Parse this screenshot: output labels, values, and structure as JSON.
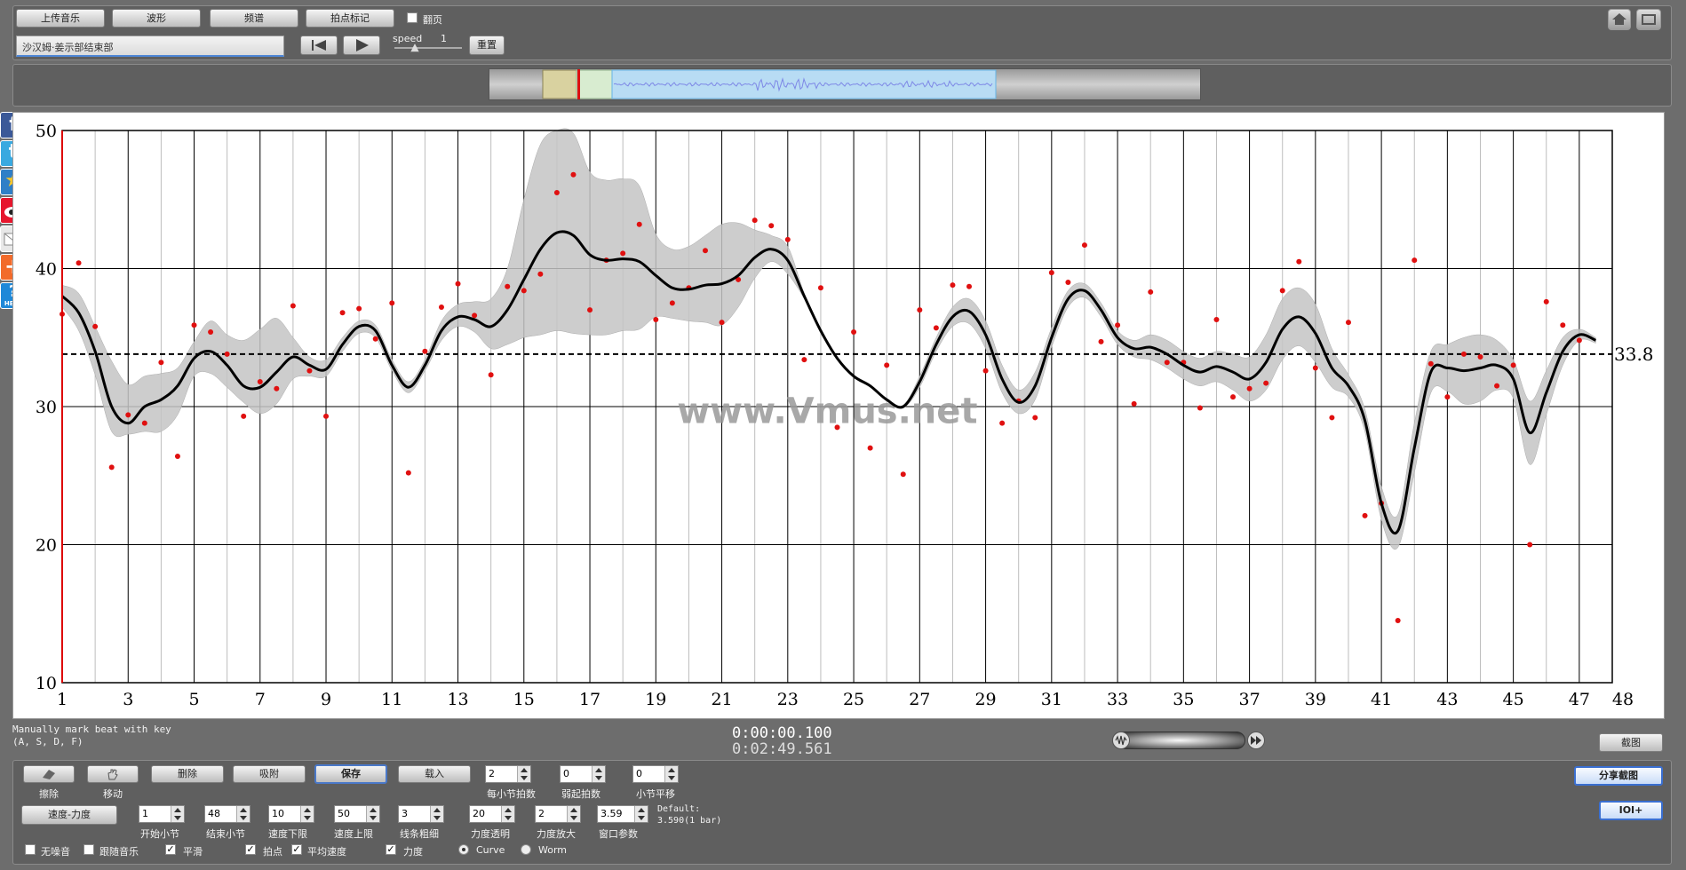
{
  "toolbar": {
    "upload_music": "上传音乐",
    "waveform": "波形",
    "spectrum": "频谱",
    "beat_mark": "拍点标记",
    "flip_page": "翻页",
    "track_title": "沙汉姆·姜示部结束部",
    "speed_label": "speed",
    "speed_value": "1",
    "reset": "重置"
  },
  "social": {
    "facebook": "f",
    "twitter": "t",
    "add": "+",
    "help": "?",
    "help_text": "HELP"
  },
  "chart_data": {
    "type": "line",
    "title": "",
    "xlabel": "",
    "ylabel": "",
    "x_ticks": [
      1,
      3,
      5,
      7,
      9,
      11,
      13,
      15,
      17,
      19,
      21,
      23,
      25,
      27,
      29,
      31,
      33,
      35,
      37,
      39,
      41,
      43,
      45,
      47,
      48
    ],
    "y_ticks": [
      10,
      20,
      30,
      40,
      50
    ],
    "xlim": [
      1,
      48
    ],
    "ylim": [
      10,
      50
    ],
    "grid": true,
    "average": 33.8,
    "average_label": "33.8",
    "watermark": "www.Vmus.net",
    "curve": [
      [
        1.0,
        38
      ],
      [
        1.5,
        36.8
      ],
      [
        2.0,
        34
      ],
      [
        2.5,
        30
      ],
      [
        3.0,
        28.8
      ],
      [
        3.5,
        30
      ],
      [
        4.0,
        30.5
      ],
      [
        4.5,
        31.5
      ],
      [
        5.0,
        33.5
      ],
      [
        5.5,
        34
      ],
      [
        6.0,
        33
      ],
      [
        6.5,
        31.5
      ],
      [
        7.0,
        31.4
      ],
      [
        7.5,
        32.5
      ],
      [
        8.0,
        33.6
      ],
      [
        8.5,
        33
      ],
      [
        9.0,
        32.7
      ],
      [
        9.5,
        34.5
      ],
      [
        10.0,
        35.8
      ],
      [
        10.5,
        35.5
      ],
      [
        11.0,
        33
      ],
      [
        11.5,
        31.4
      ],
      [
        12.0,
        33
      ],
      [
        12.5,
        35.5
      ],
      [
        13.0,
        36.5
      ],
      [
        13.5,
        36.3
      ],
      [
        14.0,
        35.8
      ],
      [
        14.5,
        37
      ],
      [
        15.0,
        39.2
      ],
      [
        15.5,
        41.4
      ],
      [
        16.0,
        42.6
      ],
      [
        16.5,
        42.4
      ],
      [
        17.0,
        41
      ],
      [
        17.5,
        40.6
      ],
      [
        18.0,
        40.7
      ],
      [
        18.5,
        40.5
      ],
      [
        19.0,
        39.5
      ],
      [
        19.5,
        38.6
      ],
      [
        20.0,
        38.5
      ],
      [
        20.5,
        38.8
      ],
      [
        21.0,
        38.9
      ],
      [
        21.5,
        39.5
      ],
      [
        22.0,
        40.8
      ],
      [
        22.5,
        41.4
      ],
      [
        23.0,
        40.6
      ],
      [
        23.5,
        38
      ],
      [
        24.0,
        35.5
      ],
      [
        24.5,
        33.5
      ],
      [
        25.0,
        32.2
      ],
      [
        25.5,
        31.5
      ],
      [
        26.0,
        30.5
      ],
      [
        26.5,
        30
      ],
      [
        27.0,
        31.8
      ],
      [
        27.5,
        34.5
      ],
      [
        28.0,
        36.5
      ],
      [
        28.5,
        36.9
      ],
      [
        29.0,
        35.2
      ],
      [
        29.5,
        32
      ],
      [
        30.0,
        30.3
      ],
      [
        30.5,
        31.5
      ],
      [
        31.0,
        35
      ],
      [
        31.5,
        37.8
      ],
      [
        32.0,
        38.4
      ],
      [
        32.5,
        37
      ],
      [
        33.0,
        35
      ],
      [
        33.5,
        34.2
      ],
      [
        34.0,
        34.3
      ],
      [
        34.5,
        33.8
      ],
      [
        35.0,
        33
      ],
      [
        35.5,
        32.5
      ],
      [
        36.0,
        32.9
      ],
      [
        36.5,
        32.5
      ],
      [
        37.0,
        32
      ],
      [
        37.5,
        33.2
      ],
      [
        38.0,
        35.6
      ],
      [
        38.5,
        36.5
      ],
      [
        39.0,
        35.3
      ],
      [
        39.5,
        32.8
      ],
      [
        40.0,
        31.5
      ],
      [
        40.5,
        29
      ],
      [
        41.0,
        23
      ],
      [
        41.5,
        21
      ],
      [
        42.0,
        27
      ],
      [
        42.5,
        32.5
      ],
      [
        43.0,
        32.8
      ],
      [
        43.5,
        32.6
      ],
      [
        44.0,
        32.8
      ],
      [
        44.5,
        33
      ],
      [
        45.0,
        32
      ],
      [
        45.5,
        28.1
      ],
      [
        46.0,
        31
      ],
      [
        46.5,
        34
      ],
      [
        47.0,
        35.2
      ],
      [
        47.5,
        34.8
      ]
    ],
    "band_upper": [
      [
        1.0,
        38.8
      ],
      [
        1.5,
        38.2
      ],
      [
        2.0,
        35.8
      ],
      [
        2.5,
        33.3
      ],
      [
        3.0,
        31.6
      ],
      [
        3.5,
        32.2
      ],
      [
        4.0,
        32.4
      ],
      [
        4.5,
        32.8
      ],
      [
        5.0,
        34.7
      ],
      [
        5.5,
        36.2
      ],
      [
        6.0,
        35.2
      ],
      [
        6.5,
        34.8
      ],
      [
        7.0,
        35.6
      ],
      [
        7.5,
        36.4
      ],
      [
        8.0,
        35
      ],
      [
        8.5,
        33.6
      ],
      [
        9.0,
        33.4
      ],
      [
        9.5,
        35
      ],
      [
        10.0,
        36.2
      ],
      [
        10.5,
        35.9
      ],
      [
        11.0,
        33.4
      ],
      [
        11.5,
        31.8
      ],
      [
        12.0,
        33.4
      ],
      [
        12.5,
        36.2
      ],
      [
        13.0,
        37.4
      ],
      [
        13.5,
        37.6
      ],
      [
        14.0,
        37.8
      ],
      [
        14.5,
        40
      ],
      [
        15.0,
        45
      ],
      [
        15.5,
        49
      ],
      [
        16.0,
        50
      ],
      [
        16.5,
        49.8
      ],
      [
        17.0,
        47
      ],
      [
        17.5,
        46.4
      ],
      [
        18.0,
        46.5
      ],
      [
        18.5,
        46
      ],
      [
        19.0,
        42.5
      ],
      [
        19.5,
        41.4
      ],
      [
        20.0,
        41.6
      ],
      [
        20.5,
        42.4
      ],
      [
        21.0,
        43.2
      ],
      [
        21.5,
        43.3
      ],
      [
        22.0,
        42.8
      ],
      [
        22.5,
        42.4
      ],
      [
        23.0,
        41.6
      ],
      [
        23.5,
        38.2
      ],
      [
        24.0,
        35.6
      ],
      [
        24.5,
        33.6
      ],
      [
        25.0,
        32.3
      ],
      [
        25.5,
        31.6
      ],
      [
        26.0,
        30.6
      ],
      [
        26.5,
        30.1
      ],
      [
        27.0,
        32.2
      ],
      [
        27.5,
        35
      ],
      [
        28.0,
        37.2
      ],
      [
        28.5,
        37.8
      ],
      [
        29.0,
        36.2
      ],
      [
        29.5,
        33
      ],
      [
        30.0,
        31.2
      ],
      [
        30.5,
        32.5
      ],
      [
        31.0,
        35.7
      ],
      [
        31.5,
        38.4
      ],
      [
        32.0,
        38.9
      ],
      [
        32.5,
        37.5
      ],
      [
        33.0,
        35.5
      ],
      [
        33.5,
        34.8
      ],
      [
        34.0,
        35.2
      ],
      [
        34.5,
        34.8
      ],
      [
        35.0,
        34
      ],
      [
        35.5,
        33.5
      ],
      [
        36.0,
        34
      ],
      [
        36.5,
        33.8
      ],
      [
        37.0,
        33.6
      ],
      [
        37.5,
        35.2
      ],
      [
        38.0,
        37.8
      ],
      [
        38.5,
        38.6
      ],
      [
        39.0,
        37.4
      ],
      [
        39.5,
        34.2
      ],
      [
        40.0,
        32.3
      ],
      [
        40.5,
        29.8
      ],
      [
        41.0,
        24.2
      ],
      [
        41.5,
        22.2
      ],
      [
        42.0,
        28.8
      ],
      [
        42.5,
        34
      ],
      [
        43.0,
        34.5
      ],
      [
        43.5,
        35
      ],
      [
        44.0,
        35.2
      ],
      [
        44.5,
        34.8
      ],
      [
        45.0,
        33.4
      ],
      [
        45.5,
        30.4
      ],
      [
        46.0,
        32.6
      ],
      [
        46.5,
        35
      ],
      [
        47.0,
        35.6
      ],
      [
        47.5,
        35
      ]
    ],
    "band_lower": [
      [
        1.0,
        37.2
      ],
      [
        1.5,
        35.5
      ],
      [
        2.0,
        32.3
      ],
      [
        2.5,
        28.2
      ],
      [
        3.0,
        28
      ],
      [
        3.5,
        28.2
      ],
      [
        4.0,
        28.2
      ],
      [
        4.5,
        29.4
      ],
      [
        5.0,
        32.2
      ],
      [
        5.5,
        32.4
      ],
      [
        6.0,
        31.4
      ],
      [
        6.5,
        30.3
      ],
      [
        7.0,
        29.5
      ],
      [
        7.5,
        30.2
      ],
      [
        8.0,
        32
      ],
      [
        8.5,
        32.2
      ],
      [
        9.0,
        32.2
      ],
      [
        9.5,
        34
      ],
      [
        10.0,
        35.3
      ],
      [
        10.5,
        35
      ],
      [
        11.0,
        32.6
      ],
      [
        11.5,
        31
      ],
      [
        12.0,
        32.6
      ],
      [
        12.5,
        34.8
      ],
      [
        13.0,
        35.8
      ],
      [
        13.5,
        35.4
      ],
      [
        14.0,
        34.2
      ],
      [
        14.5,
        34.5
      ],
      [
        15.0,
        35
      ],
      [
        15.5,
        35.2
      ],
      [
        16.0,
        35.5
      ],
      [
        16.5,
        35.3
      ],
      [
        17.0,
        35.2
      ],
      [
        17.5,
        35.2
      ],
      [
        18.0,
        35.5
      ],
      [
        18.5,
        35.6
      ],
      [
        19.0,
        36.5
      ],
      [
        19.5,
        36.4
      ],
      [
        20.0,
        36.2
      ],
      [
        20.5,
        36.1
      ],
      [
        21.0,
        35.9
      ],
      [
        21.5,
        37.2
      ],
      [
        22.0,
        39.3
      ],
      [
        22.5,
        40.5
      ],
      [
        23.0,
        39.6
      ],
      [
        23.5,
        37.8
      ],
      [
        24.0,
        35.4
      ],
      [
        24.5,
        33.4
      ],
      [
        25.0,
        32.1
      ],
      [
        25.5,
        31.4
      ],
      [
        26.0,
        30.4
      ],
      [
        26.5,
        29.9
      ],
      [
        27.0,
        31.4
      ],
      [
        27.5,
        34
      ],
      [
        28.0,
        35.8
      ],
      [
        28.5,
        36
      ],
      [
        29.0,
        34.2
      ],
      [
        29.5,
        31
      ],
      [
        30.0,
        29.5
      ],
      [
        30.5,
        30.5
      ],
      [
        31.0,
        34.3
      ],
      [
        31.5,
        37.2
      ],
      [
        32.0,
        37.9
      ],
      [
        32.5,
        36.5
      ],
      [
        33.0,
        34.5
      ],
      [
        33.5,
        33.6
      ],
      [
        34.0,
        33.4
      ],
      [
        34.5,
        32.8
      ],
      [
        35.0,
        32
      ],
      [
        35.5,
        31.5
      ],
      [
        36.0,
        31.8
      ],
      [
        36.5,
        31.2
      ],
      [
        37.0,
        30.4
      ],
      [
        37.5,
        31.2
      ],
      [
        38.0,
        33.4
      ],
      [
        38.5,
        34.4
      ],
      [
        39.0,
        33.2
      ],
      [
        39.5,
        31.4
      ],
      [
        40.0,
        30.7
      ],
      [
        40.5,
        28.2
      ],
      [
        41.0,
        21.8
      ],
      [
        41.5,
        19.8
      ],
      [
        42.0,
        25.2
      ],
      [
        42.5,
        31
      ],
      [
        43.0,
        31.1
      ],
      [
        43.5,
        30.2
      ],
      [
        44.0,
        30.4
      ],
      [
        44.5,
        31.2
      ],
      [
        45.0,
        30.6
      ],
      [
        45.5,
        25.8
      ],
      [
        46.0,
        29.4
      ],
      [
        46.5,
        33
      ],
      [
        47.0,
        34.8
      ],
      [
        47.5,
        34.6
      ]
    ],
    "points": [
      [
        1.0,
        36.7
      ],
      [
        1.5,
        40.4
      ],
      [
        2.0,
        35.8
      ],
      [
        2.5,
        25.6
      ],
      [
        3.0,
        29.4
      ],
      [
        3.5,
        28.8
      ],
      [
        4.0,
        33.2
      ],
      [
        4.5,
        26.4
      ],
      [
        5.0,
        35.9
      ],
      [
        5.5,
        35.4
      ],
      [
        6.0,
        33.8
      ],
      [
        6.5,
        29.3
      ],
      [
        7.0,
        31.8
      ],
      [
        7.5,
        31.3
      ],
      [
        8.0,
        37.3
      ],
      [
        8.5,
        32.6
      ],
      [
        9.0,
        29.3
      ],
      [
        9.5,
        36.8
      ],
      [
        10.0,
        37.1
      ],
      [
        10.5,
        34.9
      ],
      [
        11.0,
        37.5
      ],
      [
        11.5,
        25.2
      ],
      [
        12.0,
        34
      ],
      [
        12.5,
        37.2
      ],
      [
        13.0,
        38.9
      ],
      [
        13.5,
        36.6
      ],
      [
        14.0,
        32.3
      ],
      [
        14.5,
        38.7
      ],
      [
        15.0,
        38.4
      ],
      [
        15.5,
        39.6
      ],
      [
        16.0,
        45.5
      ],
      [
        16.5,
        46.8
      ],
      [
        17.0,
        37
      ],
      [
        17.5,
        40.6
      ],
      [
        18.0,
        41.1
      ],
      [
        18.5,
        43.2
      ],
      [
        19.0,
        36.3
      ],
      [
        19.5,
        37.5
      ],
      [
        20.0,
        38.6
      ],
      [
        20.5,
        41.3
      ],
      [
        21.0,
        36.1
      ],
      [
        21.5,
        39.2
      ],
      [
        22.0,
        43.5
      ],
      [
        22.5,
        43.1
      ],
      [
        23.0,
        42.1
      ],
      [
        23.5,
        33.4
      ],
      [
        24.0,
        38.6
      ],
      [
        24.5,
        28.5
      ],
      [
        25.0,
        35.4
      ],
      [
        25.5,
        27
      ],
      [
        26.0,
        33
      ],
      [
        26.5,
        25.1
      ],
      [
        27.0,
        37
      ],
      [
        27.5,
        35.7
      ],
      [
        28.0,
        38.8
      ],
      [
        28.5,
        38.7
      ],
      [
        29.0,
        32.6
      ],
      [
        29.5,
        28.8
      ],
      [
        30.0,
        30.4
      ],
      [
        30.5,
        29.2
      ],
      [
        31.0,
        39.7
      ],
      [
        31.5,
        39
      ],
      [
        32.0,
        41.7
      ],
      [
        32.5,
        34.7
      ],
      [
        33.0,
        35.9
      ],
      [
        33.5,
        30.2
      ],
      [
        34.0,
        38.3
      ],
      [
        34.5,
        33.2
      ],
      [
        35.0,
        33.2
      ],
      [
        35.5,
        29.9
      ],
      [
        36.0,
        36.3
      ],
      [
        36.5,
        30.7
      ],
      [
        37.0,
        31.3
      ],
      [
        37.5,
        31.7
      ],
      [
        38.0,
        38.4
      ],
      [
        38.5,
        40.5
      ],
      [
        39.0,
        32.8
      ],
      [
        39.5,
        29.2
      ],
      [
        40.0,
        36.1
      ],
      [
        40.5,
        22.1
      ],
      [
        41.0,
        23
      ],
      [
        41.5,
        14.5
      ],
      [
        42.0,
        40.6
      ],
      [
        42.5,
        33.1
      ],
      [
        43.0,
        30.7
      ],
      [
        43.5,
        33.8
      ],
      [
        44.0,
        33.6
      ],
      [
        44.5,
        31.5
      ],
      [
        45.0,
        33
      ],
      [
        45.5,
        20
      ],
      [
        46.0,
        37.6
      ],
      [
        46.5,
        35.9
      ],
      [
        47.0,
        34.8
      ]
    ]
  },
  "status": {
    "hint_line1": "Manually mark beat with key",
    "hint_line2": "(A, S, D, F)",
    "current_time": "0:00:00.100",
    "total_time": "0:02:49.561",
    "screenshot": "截图"
  },
  "bottom": {
    "erase": "擦除",
    "move": "移动",
    "delete": "删除",
    "snap": "吸附",
    "save": "保存",
    "load": "载入",
    "beats_per_bar_val": "2",
    "beats_per_bar": "每小节拍数",
    "pickup_beats_val": "0",
    "pickup_beats": "弱起拍数",
    "bar_offset_val": "0",
    "bar_offset": "小节平移",
    "tempo_dynamics": "速度-力度",
    "start_bar_val": "1",
    "start_bar": "开始小节",
    "end_bar_val": "48",
    "end_bar": "结束小节",
    "tempo_min_val": "10",
    "tempo_min": "速度下限",
    "tempo_max_val": "50",
    "tempo_max": "速度上限",
    "curve_width_val": "3",
    "curve_width": "线条粗细",
    "dyn_transparency_val": "20",
    "dyn_transparency": "力度透明",
    "dyn_zoom_val": "2",
    "dyn_zoom": "力度放大",
    "window_param_val": "3.59",
    "window_param": "窗口参数",
    "default_line1": "Default:",
    "default_line2": "3.590(1 bar)",
    "no_noise": "无噪音",
    "follow_music": "跟随音乐",
    "smooth": "平滑",
    "beat_points": "拍点",
    "avg_tempo": "平均速度",
    "dynamics": "力度",
    "curve_opt": "Curve",
    "worm_opt": "Worm",
    "share_screenshot": "分享截图",
    "ioi": "IOI+"
  }
}
